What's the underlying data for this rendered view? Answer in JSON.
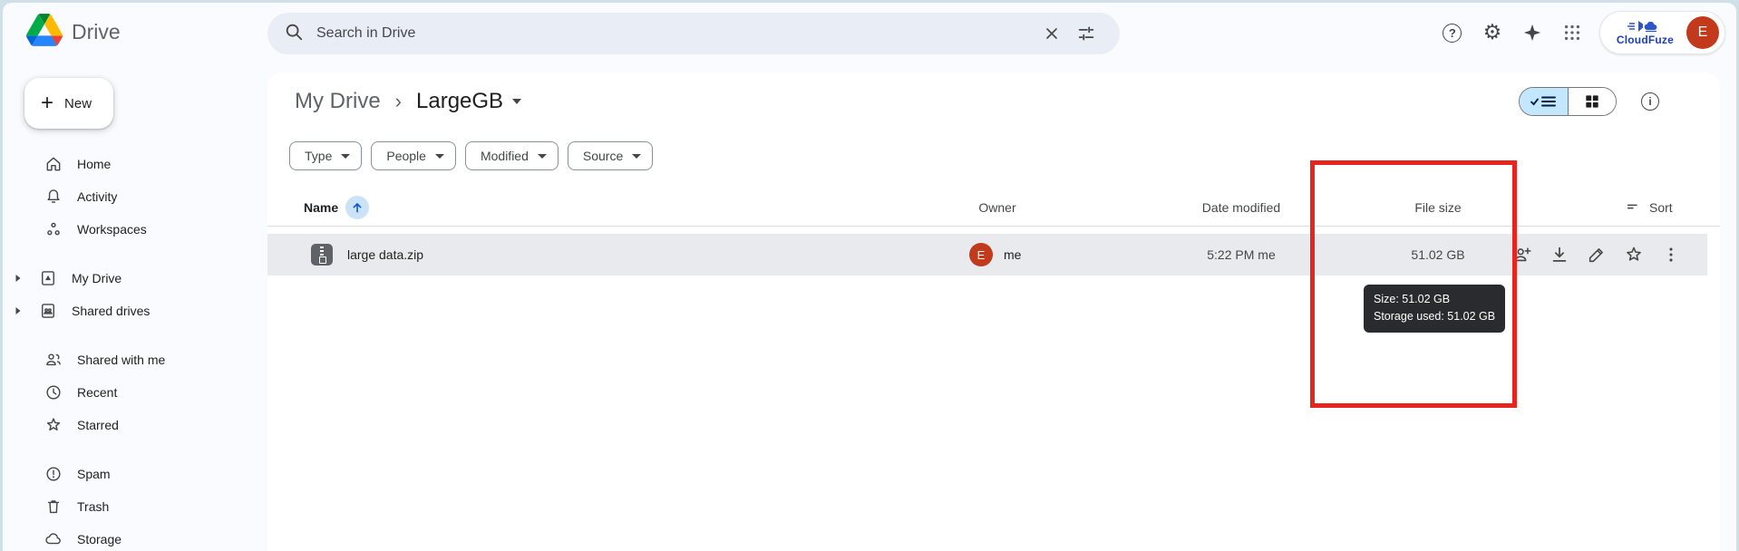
{
  "topbar": {
    "brand": "Drive",
    "search": {
      "placeholder": "Search in Drive"
    },
    "cloudfuze_label": "CloudFuze",
    "avatar_initial": "E",
    "glyphs": {
      "help": "?",
      "gear": "⚙",
      "info": "i"
    }
  },
  "sidebar": {
    "new_button": "New",
    "new_plus": "+",
    "items": {
      "home": "Home",
      "activity": "Activity",
      "workspaces": "Workspaces",
      "my_drive": "My Drive",
      "shared_drives": "Shared drives",
      "shared_with_me": "Shared with me",
      "recent": "Recent",
      "starred": "Starred",
      "spam": "Spam",
      "trash": "Trash",
      "storage": "Storage"
    }
  },
  "breadcrumb": {
    "root": "My Drive",
    "separator": "›",
    "current": "LargeGB"
  },
  "filters": {
    "type": "Type",
    "people": "People",
    "modified": "Modified",
    "source": "Source"
  },
  "table": {
    "headers": {
      "name": "Name",
      "owner": "Owner",
      "date_modified": "Date modified",
      "file_size": "File size",
      "sort": "Sort"
    },
    "rows": [
      {
        "name": "large data.zip",
        "owner": "me",
        "date_modified": "5:22 PM me",
        "file_size": "51.02 GB"
      }
    ]
  },
  "tooltip": {
    "size": "Size: 51.02 GB",
    "storage_used": "Storage used: 51.02 GB"
  },
  "colors": {
    "annotation_red": "#e8241f",
    "selection_blue": "#c2e7ff",
    "accent_blue": "#0b57d0",
    "avatar_red": "#c23a1b",
    "cloudfuze_blue": "#1c3eb8",
    "tooltip_bg": "#2a2b2e"
  }
}
